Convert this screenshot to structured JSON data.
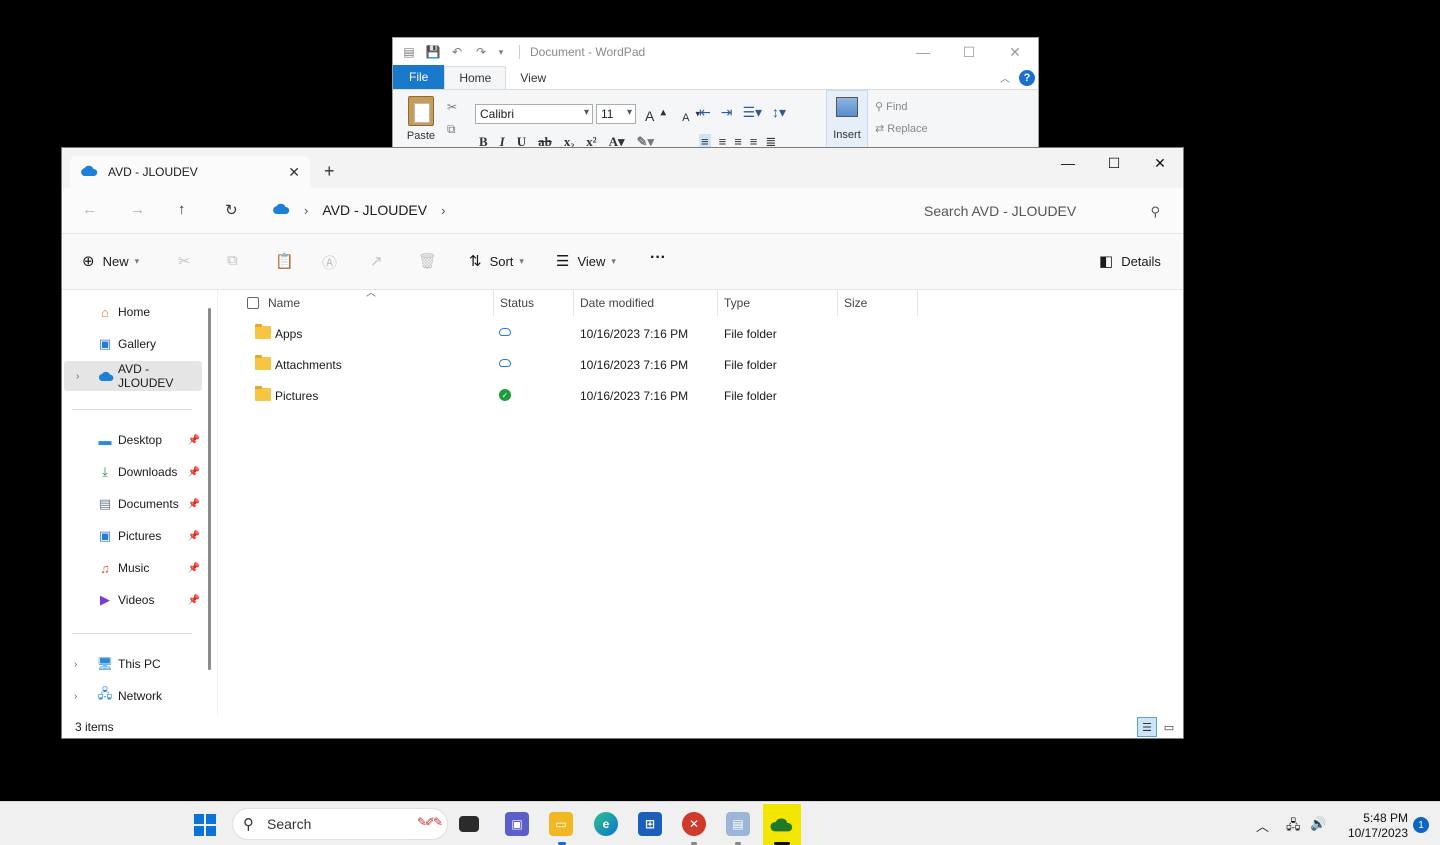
{
  "wordpad": {
    "title": "Document - WordPad",
    "tabs": [
      "File",
      "Home",
      "View"
    ],
    "font_name": "Calibri",
    "font_size": "11",
    "paste_label": "Paste",
    "insert_label": "Insert",
    "find_label": "Find",
    "replace_label": "Replace",
    "help_label": "?"
  },
  "explorer": {
    "tab_title": "AVD - JLOUDEV",
    "breadcrumb": [
      "AVD - JLOUDEV"
    ],
    "search_placeholder": "Search AVD - JLOUDEV",
    "toolbar": {
      "new_label": "New",
      "sort_label": "Sort",
      "view_label": "View",
      "more_label": "···",
      "details_label": "Details"
    },
    "sidebar": {
      "top": [
        {
          "label": "Home",
          "icon": "home-icon"
        },
        {
          "label": "Gallery",
          "icon": "gallery-icon"
        },
        {
          "label": "AVD - JLOUDEV",
          "icon": "onedrive-icon",
          "selected": true
        }
      ],
      "quick": [
        {
          "label": "Desktop",
          "icon": "desktop-icon"
        },
        {
          "label": "Downloads",
          "icon": "download-icon"
        },
        {
          "label": "Documents",
          "icon": "document-icon"
        },
        {
          "label": "Pictures",
          "icon": "pictures-icon"
        },
        {
          "label": "Music",
          "icon": "music-icon"
        },
        {
          "label": "Videos",
          "icon": "videos-icon"
        }
      ],
      "bottom": [
        {
          "label": "This PC",
          "icon": "pc-icon"
        },
        {
          "label": "Network",
          "icon": "network-icon"
        }
      ]
    },
    "columns": {
      "name": "Name",
      "status": "Status",
      "date": "Date modified",
      "type": "Type",
      "size": "Size"
    },
    "files": [
      {
        "name": "Apps",
        "status": "cloud",
        "date": "10/16/2023 7:16 PM",
        "type": "File folder"
      },
      {
        "name": "Attachments",
        "status": "cloud",
        "date": "10/16/2023 7:16 PM",
        "type": "File folder"
      },
      {
        "name": "Pictures",
        "status": "available",
        "date": "10/16/2023 7:16 PM",
        "type": "File folder"
      }
    ],
    "status_text": "3 items"
  },
  "taskbar": {
    "search_label": "Search",
    "time": "5:48 PM",
    "date": "10/17/2023",
    "notification_count": "1"
  },
  "colors": {
    "accent": "#0a72d8",
    "onedrive": "#1e7fd8",
    "synced": "#1d9a3a",
    "highlight": "#f3e600"
  }
}
